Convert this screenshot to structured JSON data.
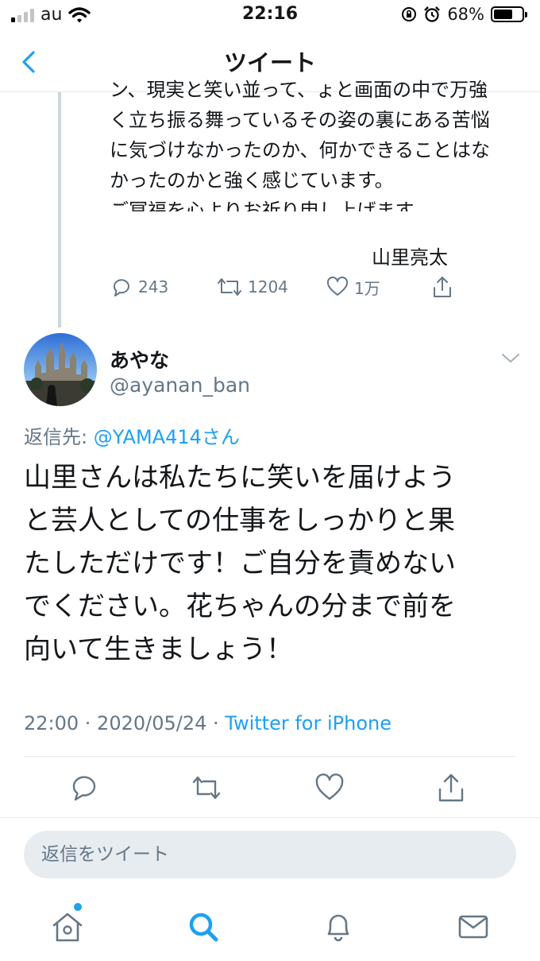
{
  "status_bar": {
    "carrier": "au",
    "time": "22:16",
    "battery_percent": "68%",
    "battery_level": 0.68
  },
  "nav": {
    "title": "ツイート"
  },
  "previous_tweet": {
    "clipped_line": "ン、現実と笑い並って、ょと画面の中で万強",
    "lines": [
      "く立ち振る舞っているその姿の裏にある苦悩",
      "に気づけなかったのか、何かできることはな",
      "かったのかと強く感じています。",
      "ご冥福を心よりお祈り申し上げます。"
    ],
    "signature": "山里亮太",
    "replies": "243",
    "retweets": "1204",
    "likes": "1万"
  },
  "tweet": {
    "display_name": "あやな",
    "handle": "@ayanan_ban",
    "reply_label": "返信先:",
    "reply_mention": "@YAMA414さん",
    "body_lines": [
      "山里さんは私たちに笑いを届けよう",
      "と芸人としての仕事をしっかりと果",
      "たしただけです！ご自分を責めない",
      "でください。花ちゃんの分まで前を",
      "向いて生きましょう！"
    ],
    "timestamp": "22:00 · 2020/05/24 · ",
    "source": "Twitter for iPhone"
  },
  "compose": {
    "placeholder": "返信をツイート"
  },
  "icons": [
    "chevron-left-icon",
    "reply-icon",
    "retweet-icon",
    "like-icon",
    "share-icon",
    "chevron-down-icon",
    "home-icon",
    "search-icon",
    "notifications-icon",
    "messages-icon"
  ],
  "colors": {
    "accent": "#1da1f2",
    "secondary_text": "#657786",
    "divider": "#e1e8ed",
    "compose_bg": "#e6ecf0"
  }
}
